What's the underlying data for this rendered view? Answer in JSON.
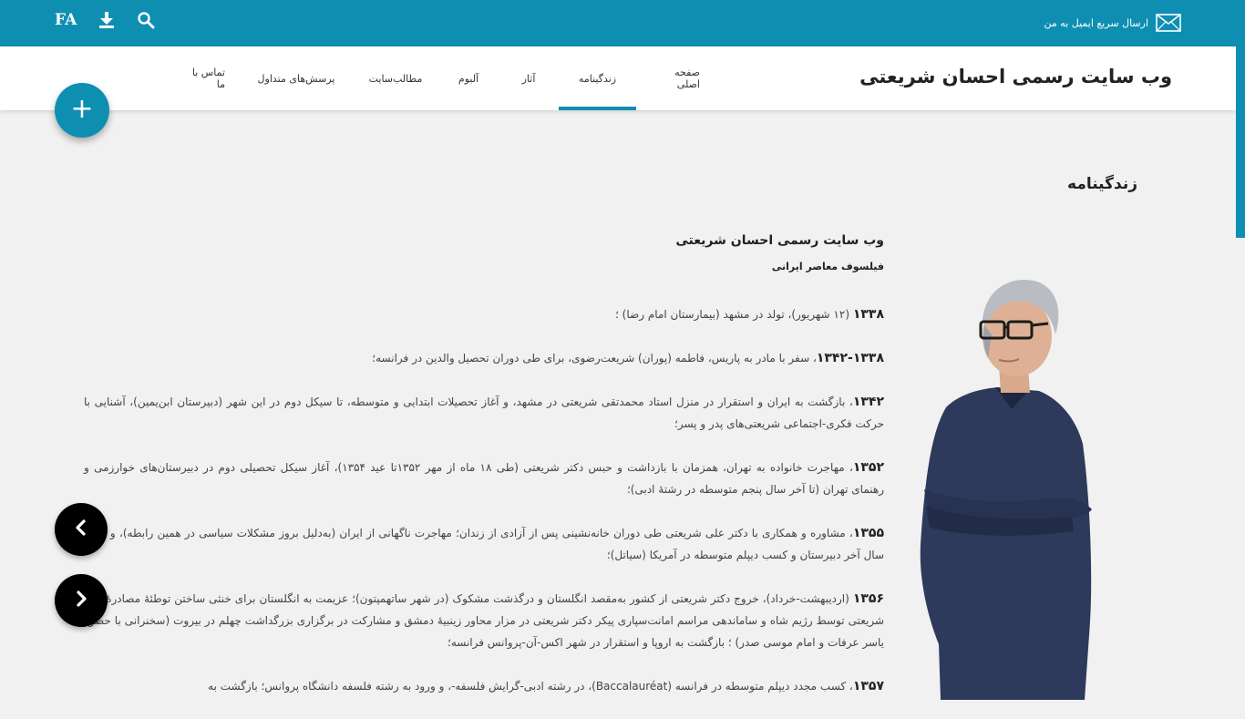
{
  "topbar": {
    "email_label": "ارسال سریع ایمیل به من",
    "lang": "FA",
    "icons": [
      "mail-icon",
      "download-icon",
      "search-icon"
    ]
  },
  "header": {
    "site_title": "وب سایت رسمی احسان شریعتی",
    "nav": [
      {
        "label": "صفحه اصلی"
      },
      {
        "label": "زندگینامه"
      },
      {
        "label": "آثار"
      },
      {
        "label": "آلبوم"
      },
      {
        "label": "مطالب‌سایت"
      },
      {
        "label": "پرسش‌های متداول"
      },
      {
        "label": "تماس با ما"
      }
    ]
  },
  "fab": {
    "label": "+"
  },
  "section_heading": "زندگینامه",
  "article": {
    "title": "وب سایت رسمی احسان شریعتی",
    "subtitle": "فیلسوف معاصر ایرانی",
    "paragraphs": [
      {
        "year": "۱۳۳۸",
        "text": " (۱۲ شهریور)، تولد در مشهد (بیمارستان امام رضا) ؛"
      },
      {
        "year": "۱۳۴۲-۱۳۳۸",
        "text": "، سفر با مادر به پاریس، فاطمه (پوران) شریعت‌رضوی، برای طی دوران تحصیل والدین در فرانسه؛"
      },
      {
        "year": "۱۳۴۲",
        "text": "، بازگشت به ایران و استقرار در منزل استاد محمدتقی شریعتی در مشهد، و آغاز تحصیلات ابتدایی و متوسطه، تا سیکل دوم در این شهر (دبیرستان ابن‌یمین)، آشنایی با حرکت فکری-اجتماعی شریعتی‌های پدر و پسر؛"
      },
      {
        "year": "۱۳۵۲",
        "text": "، مهاجرت خانواده به تهران، همزمان با بازداشت و حبس دکتر شریعتی (طی ۱۸ ماه از مهر ۱۳۵۲تا عید ۱۳۵۴)، آغاز سیکل تحصیلی دوم در دبیرستان‌های خوارزمی و رهنمای تهران (تا آخر سال پنجم متوسطه در رشتهٔ ادبی)؛"
      },
      {
        "year": "۱۳۵۵",
        "text": "، مشاوره و همکاری با دکتر علی شریعتی طی دوران خانه‌نشینی پس از آزادی از زندان؛  مهاجرت ناگهانی از ایران (به‌دلیل بروز مشکلات سیاسی در همین رابطه)، و اتمام سال آخر دبیرستان و کسب دیپلم متوسطه در آمریکا (سیاتل)؛"
      },
      {
        "year": "۱۳۵۶",
        "text": " (اردیبهشت-خرداد)، خروج دکتر شریعتی از کشور به‌مقصد انگلستان و درگذشت مشکوک (در شهر ساتهمپتون)؛  عزیمت به انگلستان برای خنثی ساختن توطئهٔ مصادرهٔ پیکر شریعتی توسط رژیم شاه و ساماندهی مراسم امانت‌سپاری پیکر دکتر شریعتی در مزار محاور زینبیهٔ دمشق و مشارکت در برگزاری بزرگداشت چهلم در بیروت (سخنرانی با حضور یاسر عرفات و امام موسی صدر) ؛ بازگشت به اروپا و استقرار در شهر اکس-آن-پروانس فرانسه؛"
      },
      {
        "year": "۱۳۵۷",
        "text": "، کسب مجدد دیپلم متوسطه در فرانسه (Baccalauréat)، در رشته ادبی-گرایش فلسفه-، و ورود به رشته فلسفه دانشگاه پروانس؛ بازگشت به"
      }
    ]
  },
  "colors": {
    "accent": "#0e8fb2",
    "background": "#f1f1f1"
  }
}
